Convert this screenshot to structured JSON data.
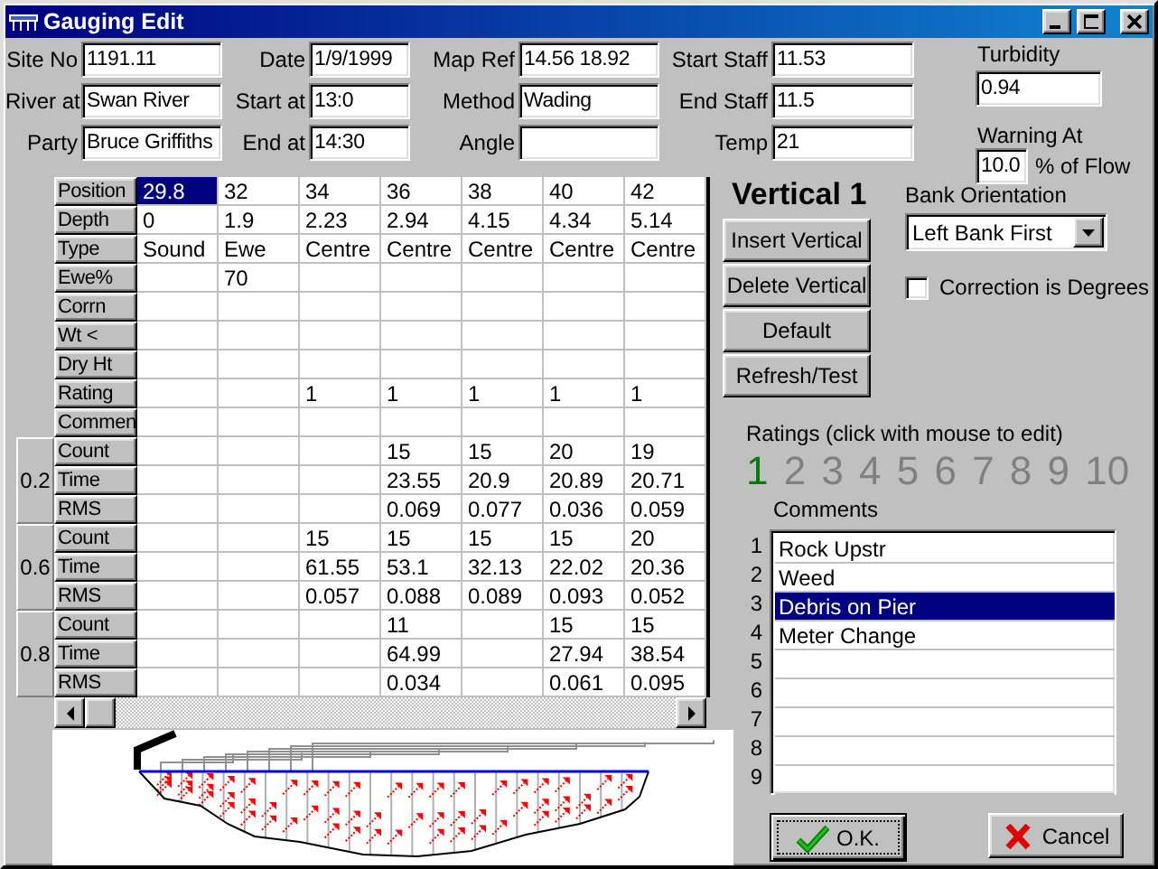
{
  "window": {
    "title": "Gauging Edit"
  },
  "fields": [
    {
      "label": "Site No",
      "value": "1191.11"
    },
    {
      "label": "Date",
      "value": "1/9/1999"
    },
    {
      "label": "Map Ref",
      "value": "14.56 18.92"
    },
    {
      "label": "Start Staff",
      "value": "11.53"
    },
    {
      "label": "River at",
      "value": "Swan River"
    },
    {
      "label": "Start at",
      "value": "13:0"
    },
    {
      "label": "Method",
      "value": "Wading"
    },
    {
      "label": "End Staff",
      "value": "11.5"
    },
    {
      "label": "Party",
      "value": "Bruce Griffiths"
    },
    {
      "label": "End at",
      "value": "14:30"
    },
    {
      "label": "Angle"
    },
    {
      "label": "Temp",
      "value": "21"
    }
  ],
  "turbidity": {
    "label": "Turbidity",
    "value": "0.94"
  },
  "warning": {
    "label": "Warning At",
    "value": "10.0",
    "unit": "% of Flow"
  },
  "grid": {
    "rows": [
      {
        "header": "Position",
        "cells": [
          {
            "text": "29.8",
            "selected": true
          },
          {
            "text": "32",
            "selected": false
          },
          {
            "text": "34",
            "selected": false
          },
          {
            "text": "36",
            "selected": false
          },
          {
            "text": "38",
            "selected": false
          },
          {
            "text": "40",
            "selected": false
          },
          {
            "text": "42",
            "selected": false
          }
        ]
      },
      {
        "header": "Depth",
        "cells": [
          {
            "text": "0",
            "selected": false
          },
          {
            "text": "1.9",
            "selected": false
          },
          {
            "text": "2.23",
            "selected": false
          },
          {
            "text": "2.94",
            "selected": false
          },
          {
            "text": "4.15",
            "selected": false
          },
          {
            "text": "4.34",
            "selected": false
          },
          {
            "text": "5.14",
            "selected": false
          }
        ]
      },
      {
        "header": "Type",
        "cells": [
          {
            "text": "Sound",
            "selected": false
          },
          {
            "text": "Ewe",
            "selected": false
          },
          {
            "text": "Centre",
            "selected": false
          },
          {
            "text": "Centre",
            "selected": false
          },
          {
            "text": "Centre",
            "selected": false
          },
          {
            "text": "Centre",
            "selected": false
          },
          {
            "text": "Centre",
            "selected": false
          }
        ]
      },
      {
        "header": "Ewe%",
        "cells": [
          {
            "selected": false
          },
          {
            "text": "70",
            "selected": false
          },
          {
            "selected": false
          },
          {
            "selected": false
          },
          {
            "selected": false
          },
          {
            "selected": false
          },
          {
            "selected": false
          }
        ]
      },
      {
        "header": "Corrn",
        "cells": [
          {
            "selected": false
          },
          {
            "selected": false
          },
          {
            "selected": false
          },
          {
            "selected": false
          },
          {
            "selected": false
          },
          {
            "selected": false
          },
          {
            "selected": false
          }
        ]
      },
      {
        "header": "Wt <",
        "cells": [
          {
            "selected": false
          },
          {
            "selected": false
          },
          {
            "selected": false
          },
          {
            "selected": false
          },
          {
            "selected": false
          },
          {
            "selected": false
          },
          {
            "selected": false
          }
        ]
      },
      {
        "header": "Dry Ht",
        "cells": [
          {
            "selected": false
          },
          {
            "selected": false
          },
          {
            "selected": false
          },
          {
            "selected": false
          },
          {
            "selected": false
          },
          {
            "selected": false
          },
          {
            "selected": false
          }
        ]
      },
      {
        "header": "Rating",
        "cells": [
          {
            "selected": false
          },
          {
            "selected": false
          },
          {
            "text": "1",
            "selected": false
          },
          {
            "text": "1",
            "selected": false
          },
          {
            "text": "1",
            "selected": false
          },
          {
            "text": "1",
            "selected": false
          },
          {
            "text": "1",
            "selected": false
          }
        ]
      },
      {
        "header": "Commen",
        "cells": [
          {
            "selected": false
          },
          {
            "selected": false
          },
          {
            "selected": false
          },
          {
            "selected": false
          },
          {
            "selected": false
          },
          {
            "selected": false
          },
          {
            "selected": false
          }
        ]
      }
    ],
    "depth_groups": [
      {
        "label": "0.2",
        "rows": [
          {
            "header": "Count",
            "cells": [
              {
                "selected": false
              },
              {
                "selected": false
              },
              {
                "selected": false
              },
              {
                "text": "15",
                "selected": false
              },
              {
                "text": "15",
                "selected": false
              },
              {
                "text": "20",
                "selected": false
              },
              {
                "text": "19",
                "selected": false
              }
            ]
          },
          {
            "header": "Time",
            "cells": [
              {
                "selected": false
              },
              {
                "selected": false
              },
              {
                "selected": false
              },
              {
                "text": "23.55",
                "selected": false
              },
              {
                "text": "20.9",
                "selected": false
              },
              {
                "text": "20.89",
                "selected": false
              },
              {
                "text": "20.71",
                "selected": false
              }
            ]
          },
          {
            "header": "RMS",
            "cells": [
              {
                "selected": false
              },
              {
                "selected": false
              },
              {
                "selected": false
              },
              {
                "text": "0.069",
                "selected": false
              },
              {
                "text": "0.077",
                "selected": false
              },
              {
                "text": "0.036",
                "selected": false
              },
              {
                "text": "0.059",
                "selected": false
              }
            ]
          }
        ]
      },
      {
        "label": "0.6",
        "rows": [
          {
            "header": "Count",
            "cells": [
              {
                "selected": false
              },
              {
                "selected": false
              },
              {
                "text": "15",
                "selected": false
              },
              {
                "text": "15",
                "selected": false
              },
              {
                "text": "15",
                "selected": false
              },
              {
                "text": "15",
                "selected": false
              },
              {
                "text": "20",
                "selected": false
              }
            ]
          },
          {
            "header": "Time",
            "cells": [
              {
                "selected": false
              },
              {
                "selected": false
              },
              {
                "text": "61.55",
                "selected": false
              },
              {
                "text": "53.1",
                "selected": false
              },
              {
                "text": "32.13",
                "selected": false
              },
              {
                "text": "22.02",
                "selected": false
              },
              {
                "text": "20.36",
                "selected": false
              }
            ]
          },
          {
            "header": "RMS",
            "cells": [
              {
                "selected": false
              },
              {
                "selected": false
              },
              {
                "text": "0.057",
                "selected": false
              },
              {
                "text": "0.088",
                "selected": false
              },
              {
                "text": "0.089",
                "selected": false
              },
              {
                "text": "0.093",
                "selected": false
              },
              {
                "text": "0.052",
                "selected": false
              }
            ]
          }
        ]
      },
      {
        "label": "0.8",
        "rows": [
          {
            "header": "Count",
            "cells": [
              {
                "selected": false
              },
              {
                "selected": false
              },
              {
                "selected": false
              },
              {
                "text": "11",
                "selected": false
              },
              {
                "selected": false
              },
              {
                "text": "15",
                "selected": false
              },
              {
                "text": "15",
                "selected": false
              }
            ]
          },
          {
            "header": "Time",
            "cells": [
              {
                "selected": false
              },
              {
                "selected": false
              },
              {
                "selected": false
              },
              {
                "text": "64.99",
                "selected": false
              },
              {
                "selected": false
              },
              {
                "text": "27.94",
                "selected": false
              },
              {
                "text": "38.54",
                "selected": false
              }
            ]
          },
          {
            "header": "RMS",
            "cells": [
              {
                "selected": false
              },
              {
                "selected": false
              },
              {
                "selected": false
              },
              {
                "text": "0.034",
                "selected": false
              },
              {
                "selected": false
              },
              {
                "text": "0.061",
                "selected": false
              },
              {
                "text": "0.095",
                "selected": false
              }
            ]
          }
        ]
      }
    ]
  },
  "vertical": {
    "title": "Vertical 1",
    "buttons": [
      "Insert Vertical",
      "Delete Vertical",
      "Default",
      "Refresh/Test"
    ]
  },
  "bank_orientation": {
    "label": "Bank Orientation",
    "value": "Left Bank First"
  },
  "correction_checkbox": {
    "label": "Correction is Degrees",
    "checked": false
  },
  "ratings": {
    "label": "Ratings (click with mouse to edit)",
    "items": [
      {
        "text": "1",
        "selected": true
      },
      {
        "text": "2",
        "selected": false
      },
      {
        "text": "3",
        "selected": false
      },
      {
        "text": "4",
        "selected": false
      },
      {
        "text": "5",
        "selected": false
      },
      {
        "text": "6",
        "selected": false
      },
      {
        "text": "7",
        "selected": false
      },
      {
        "text": "8",
        "selected": false
      },
      {
        "text": "9",
        "selected": false
      },
      {
        "text": "10",
        "selected": false
      }
    ]
  },
  "comments": {
    "label": "Comments",
    "items": [
      {
        "number": "1",
        "text": "Rock Upstr",
        "selected": false
      },
      {
        "number": "2",
        "text": "Weed",
        "selected": false
      },
      {
        "number": "3",
        "text": "Debris on Pier",
        "selected": true
      },
      {
        "number": "4",
        "text": "Meter Change",
        "selected": false
      },
      {
        "number": "5",
        "selected": false
      },
      {
        "number": "6",
        "selected": false
      },
      {
        "number": "7",
        "selected": false
      },
      {
        "number": "8",
        "selected": false
      },
      {
        "number": "9",
        "selected": false
      }
    ]
  },
  "footer_buttons": [
    {
      "label": "O.K.",
      "kind": "ok",
      "focused": true
    },
    {
      "label": "Cancel",
      "kind": "cancel",
      "focused": false
    }
  ]
}
